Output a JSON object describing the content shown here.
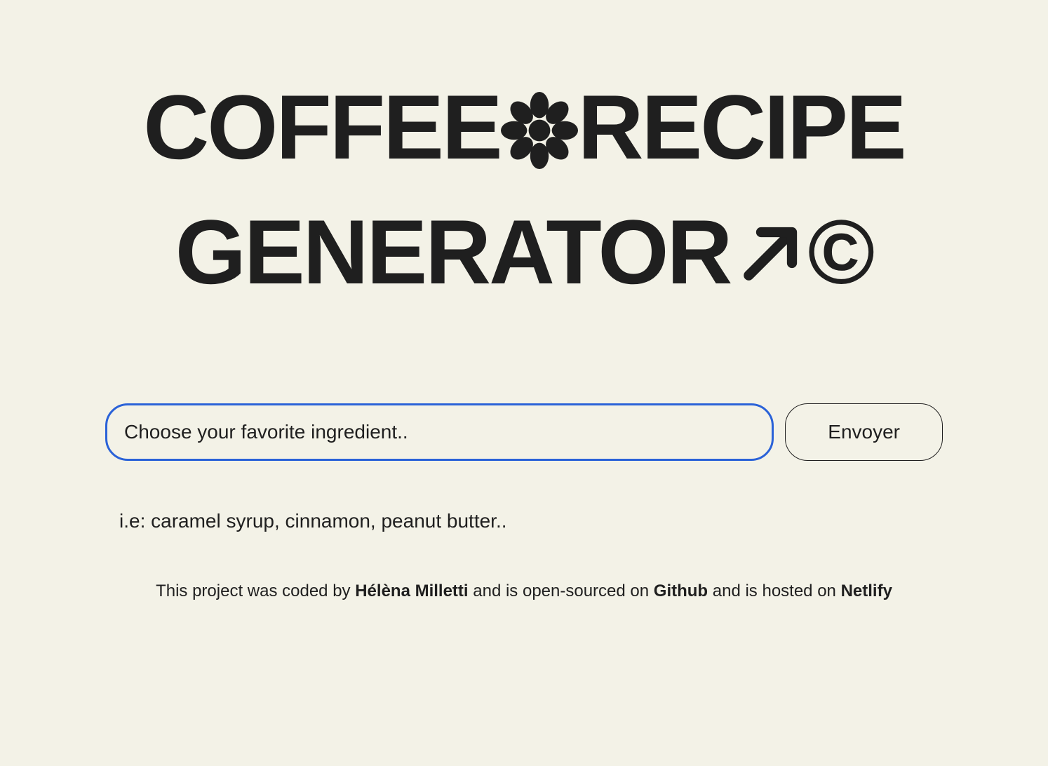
{
  "title": {
    "line1_prefix": "COFFEE",
    "line1_suffix": "RECIPE",
    "line2_prefix": "GENERATOR",
    "copyright": "©"
  },
  "form": {
    "input_placeholder": "Choose your favorite ingredient..",
    "input_value": "",
    "submit_label": "Envoyer"
  },
  "hint": "i.e: caramel syrup, cinnamon, peanut butter..",
  "footer": {
    "text1": "This project was coded by ",
    "author": "Hélèna Milletti",
    "text2": " and is open-sourced on ",
    "github": "Github",
    "text3": " and is hosted on ",
    "netlify": "Netlify"
  }
}
